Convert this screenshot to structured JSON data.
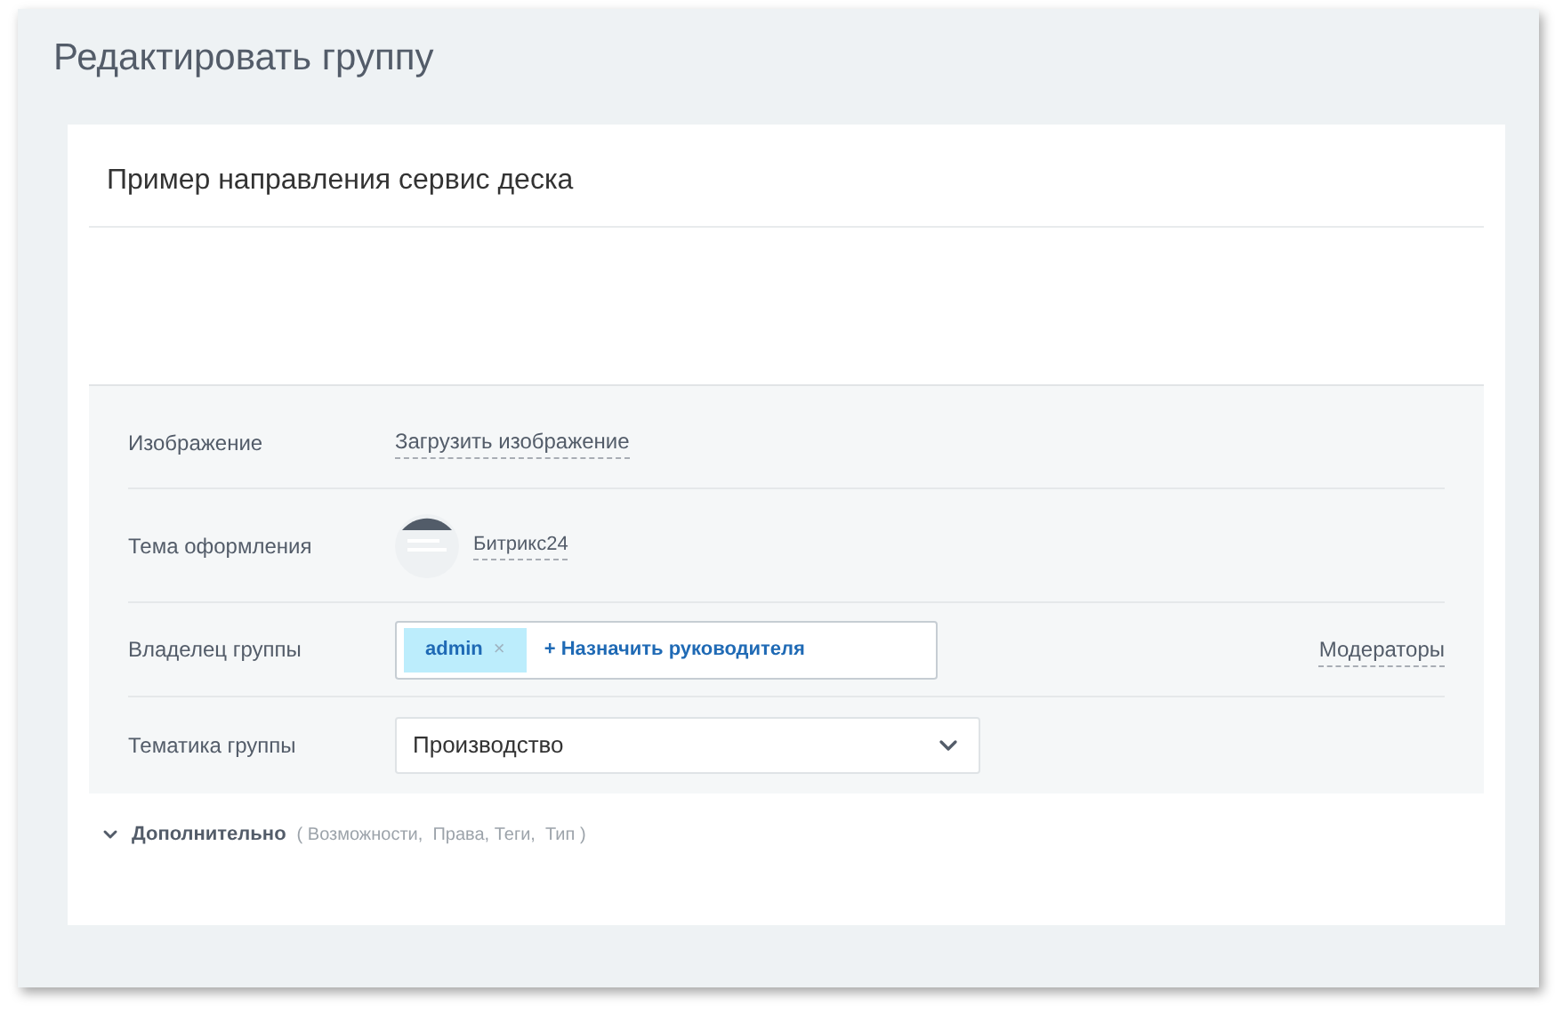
{
  "page_title": "Редактировать группу",
  "group_name": "Пример направления сервис деска",
  "fields": [
    {
      "kind": "upload",
      "label": "Изображение",
      "link": "Загрузить изображение"
    },
    {
      "kind": "theme",
      "label": "Тема оформления",
      "link": "Битрикс24"
    },
    {
      "kind": "owner",
      "label": "Владелец группы",
      "tag": "admin",
      "tag_remove": "×",
      "add_link": "+ Назначить руководителя",
      "side_link": "Модераторы"
    },
    {
      "kind": "select",
      "label": "Тематика группы",
      "value": "Производство"
    }
  ],
  "more": {
    "label": "Дополнительно",
    "expanded": false,
    "hint": "( Возможности,  Права, Теги,  Тип )"
  }
}
